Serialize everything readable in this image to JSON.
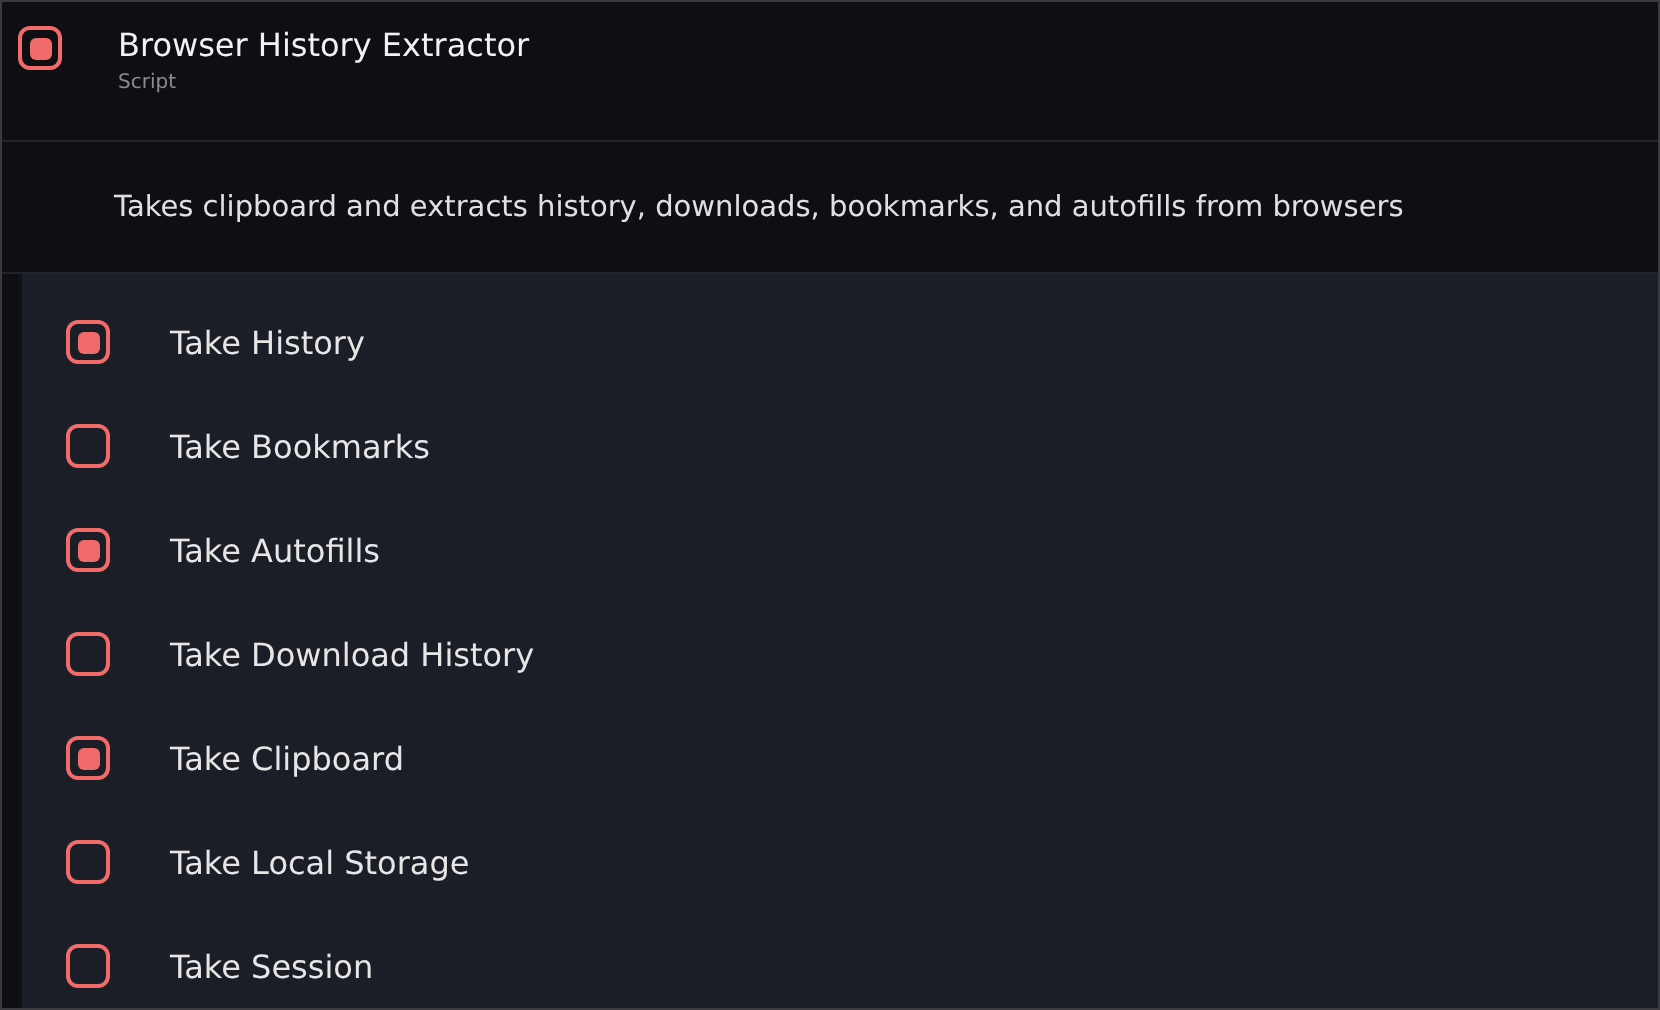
{
  "header": {
    "enabled": true,
    "title": "Browser History Extractor",
    "subtitle": "Script"
  },
  "description": "Takes clipboard and extracts history, downloads, bookmarks, and autofills from browsers",
  "options": [
    {
      "label": "Take History",
      "checked": true
    },
    {
      "label": "Take Bookmarks",
      "checked": false
    },
    {
      "label": "Take Autofills",
      "checked": true
    },
    {
      "label": "Take Download History",
      "checked": false
    },
    {
      "label": "Take Clipboard",
      "checked": true
    },
    {
      "label": "Take Local Storage",
      "checked": false
    },
    {
      "label": "Take Session",
      "checked": false
    }
  ]
}
